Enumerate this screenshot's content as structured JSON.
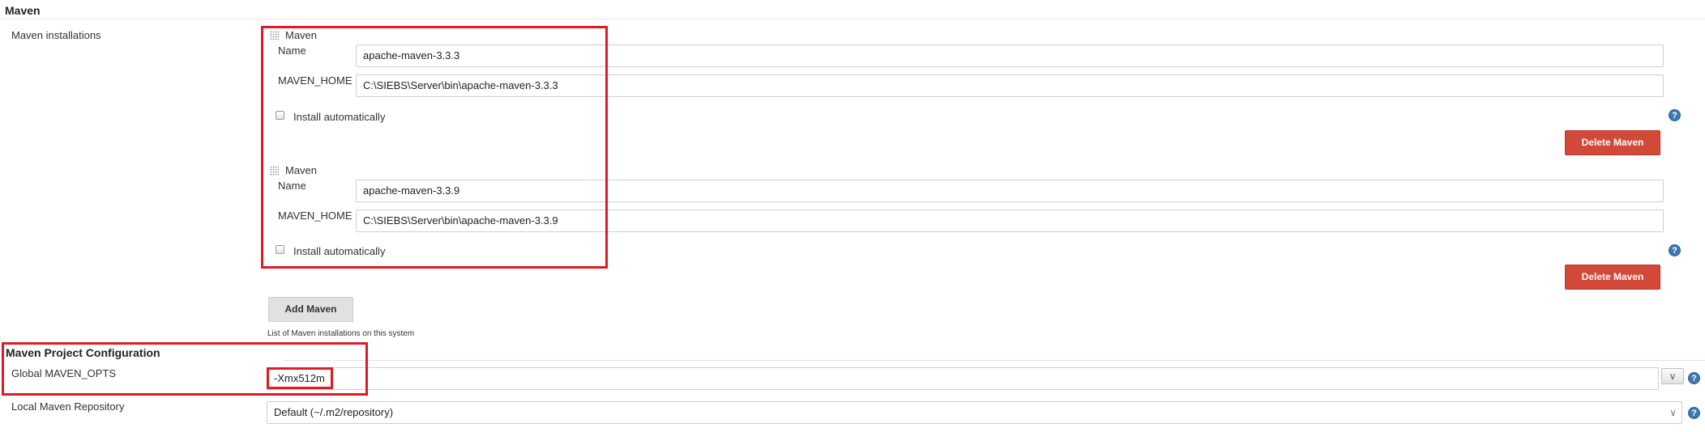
{
  "maven_section": {
    "title": "Maven",
    "installations_label": "Maven installations",
    "installations": [
      {
        "header": "Maven",
        "name_label": "Name",
        "name_value": "apache-maven-3.3.3",
        "home_label": "MAVEN_HOME",
        "home_value": "C:\\SIEBS\\Server\\bin\\apache-maven-3.3.3",
        "install_auto_label": "Install automatically",
        "delete_label": "Delete Maven",
        "help_icon": "help-icon"
      },
      {
        "header": "Maven",
        "name_label": "Name",
        "name_value": "apache-maven-3.3.9",
        "home_label": "MAVEN_HOME",
        "home_value": "C:\\SIEBS\\Server\\bin\\apache-maven-3.3.9",
        "install_auto_label": "Install automatically",
        "delete_label": "Delete Maven",
        "help_icon": "help-icon"
      }
    ],
    "add_label": "Add Maven",
    "add_hint": "List of Maven installations on this system"
  },
  "project_config": {
    "title": "Maven Project Configuration",
    "global_opts_label": "Global MAVEN_OPTS",
    "global_opts_value": "-Xmx512m",
    "expand_glyph": "∨",
    "local_repo_label": "Local Maven Repository",
    "local_repo_value": "Default (~/.m2/repository)",
    "select_glyph": "∨"
  },
  "help_glyph": "?",
  "colors": {
    "delete_button": "#d24939",
    "highlight_box": "#e01b24",
    "help_icon": "#3c78b5"
  }
}
